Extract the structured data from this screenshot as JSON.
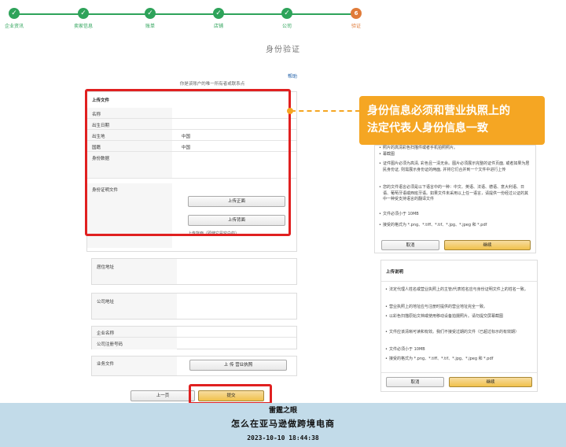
{
  "steps": [
    {
      "label": "企业资讯",
      "state": "done"
    },
    {
      "label": "卖家信息",
      "state": "done"
    },
    {
      "label": "账单",
      "state": "done"
    },
    {
      "label": "店铺",
      "state": "done"
    },
    {
      "label": "公司",
      "state": "done"
    },
    {
      "label": "验证",
      "state": "current",
      "number": "6"
    }
  ],
  "page": {
    "title": "身份验证",
    "help_link": "帮助",
    "subtitle": "你是该账户的唯一所有者或联系点"
  },
  "upload_section": {
    "header": "上传文件",
    "rows": [
      {
        "key": "名称",
        "value": ""
      },
      {
        "key": "出生日期",
        "value": ""
      },
      {
        "key": "出生地",
        "value": "中国"
      },
      {
        "key": "国籍",
        "value": "中国"
      },
      {
        "key": "身份数据",
        "value": ""
      }
    ],
    "id_doc_label": "身份证明文件",
    "upload_front": "上传正面",
    "upload_back": "上传背面",
    "back_hint": "上传背面（即使它是空白的）"
  },
  "address": {
    "label": "居住地址"
  },
  "company_address": {
    "label": "公司地址"
  },
  "company": {
    "name_label": "企业名称",
    "reg_label": "公司注册号码"
  },
  "business_docs": {
    "label": "业务文件",
    "upload_license": "上 传 营业执照"
  },
  "nav": {
    "prev": "上一页",
    "submit": "提交"
  },
  "callout": {
    "line1": "身份信息必须和营业执照上的",
    "line2": "法定代表人身份信息一致"
  },
  "panel1": {
    "partial_top": "照片的高清彩色扫描件或者手机拍照照片。",
    "partial_top2": "幕截图",
    "bullets": [
      "证件图片必须为高清, 彩色且一清无余。图片必须展示完整的证件页面, 或者如果为居民身份证, 则需展示身份证的两面, 并将它们合并到一个文件中进行上传",
      "您的文件语言必须是以下语言中的一种：中文、英语、法语、德语、意大利语、日语、葡萄牙语或西班牙语。如果文件未采用以上任一语言，请提供一份经过公证的其中一种受支持语言的翻译文件",
      "文件必须小于 10MB",
      "接受的格式为 *.png、*.tiff、*.tif、*.jpg、*.jpeg 和 *.pdf"
    ],
    "cancel": "取消",
    "continue": "继续"
  },
  "panel2": {
    "header": "上传说明",
    "bullets": [
      "法定代理人姓名或营业执照上的主管/代表姓名应与身份证明文件上的姓名一致。",
      "营业执照上的地址应与注册时提供的营业地址完全一致。",
      "以彩色扫描原始文档或使用移动设备拍摄照片。请勿提交屏幕截图",
      "文件应该清晰可读和有效。我们不接受过期的文件（已超过标示的有效期）",
      "文件必须小于 10MB",
      "接受的格式为 *.png、*.tiff、*.tif、*.jpg、*.jpeg 和 *.pdf"
    ],
    "cancel": "取消",
    "continue": "继续"
  },
  "footer": {
    "line1": "雷霆之眼",
    "line2": "怎么在亚马逊做跨境电商",
    "line3": "2023-10-10 18:44:38"
  },
  "colors": {
    "done": "#2ea35a",
    "current": "#e07b39",
    "highlight": "#e02020",
    "callout": "#f5a623",
    "footer_bg": "#c2dbe9"
  }
}
